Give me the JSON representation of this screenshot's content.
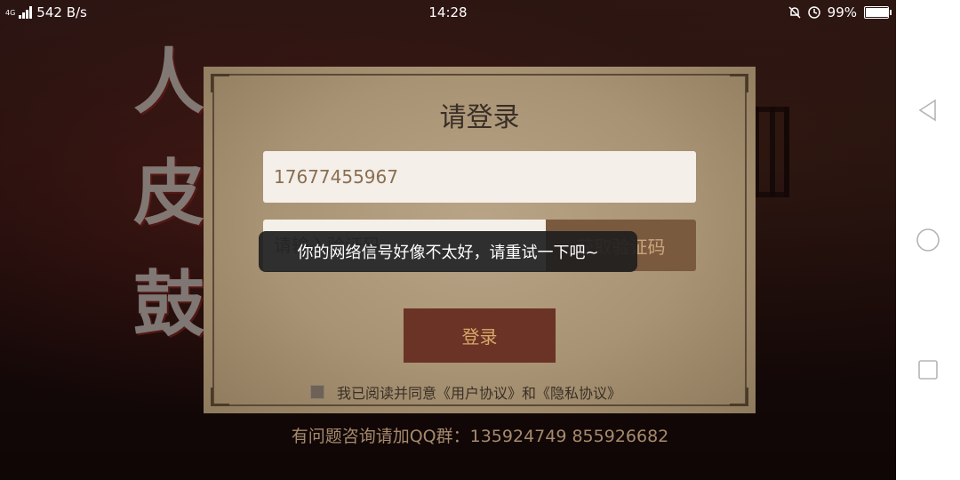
{
  "status_bar": {
    "network_label": "4G",
    "speed": "542 B/s",
    "time": "14:28",
    "battery_percent": "99%",
    "battery_level": 0.99
  },
  "background": {
    "title_chars": "人皮鼓"
  },
  "dialog": {
    "title": "请登录",
    "phone_value": "17677455967",
    "code_placeholder": "请输入验证码",
    "get_code_label": "获取验证码",
    "login_label": "登录",
    "agreement_text": "我已阅读并同意《用户协议》和《隐私协议》"
  },
  "toast": {
    "message": "你的网络信号好像不太好，请重试一下吧~"
  },
  "footer": {
    "qq_text": "有问题咨询请加QQ群：135924749 855926682"
  },
  "colors": {
    "dialog_bg": "#a89374",
    "login_button": "#6a3325",
    "code_button": "#7a5a3e",
    "toast_bg": "#1e1e1e"
  }
}
